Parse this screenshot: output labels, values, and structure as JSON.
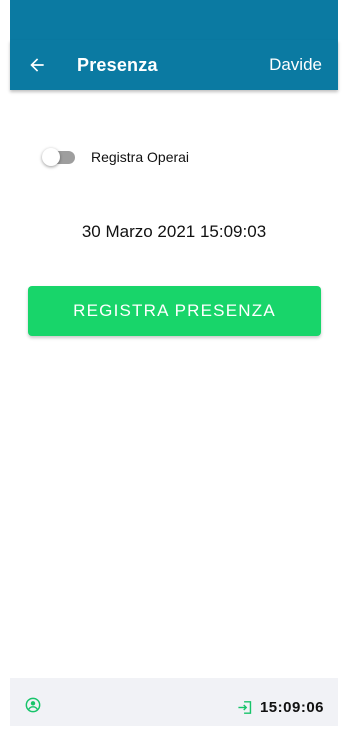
{
  "colors": {
    "primary": "#0b7aa2",
    "accent_green": "#18d56a",
    "icon_green": "#17c46a",
    "bottom_bar": "#f1f2f6"
  },
  "app_bar": {
    "back_icon": "arrow-left-icon",
    "title": "Presenza",
    "user": "Davide"
  },
  "toggle": {
    "label": "Registra Operai",
    "checked": false
  },
  "datetime": "30 Marzo 2021 15:09:03",
  "register_button": {
    "label": "REGISTRA PRESENZA"
  },
  "bottom_bar": {
    "profile_icon": "user-circle-icon",
    "login_icon": "login-icon",
    "time": "15:09:06"
  }
}
